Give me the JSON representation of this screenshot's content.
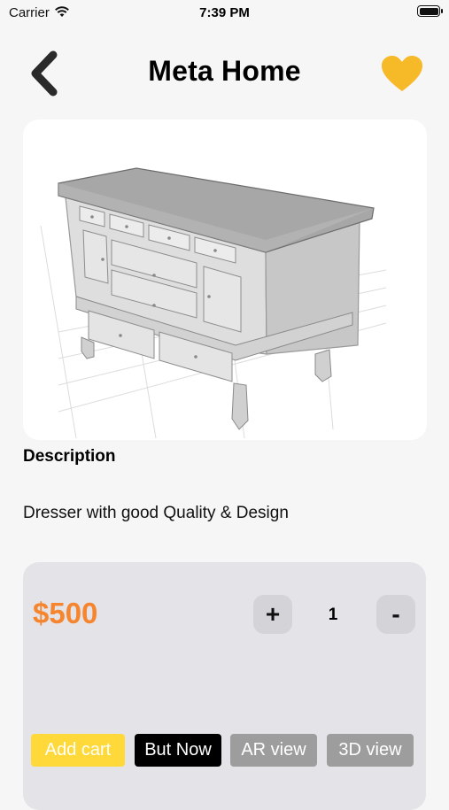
{
  "status_bar": {
    "carrier": "Carrier",
    "time": "7:39 PM"
  },
  "header": {
    "title": "Meta Home"
  },
  "product": {
    "description_heading": "Description",
    "description": "Dresser with good Quality & Design",
    "price": "$500",
    "quantity": "1"
  },
  "controls": {
    "plus": "+",
    "minus": "-"
  },
  "actions": {
    "add_cart": "Add cart",
    "buy_now": "But Now",
    "ar_view": "AR view",
    "view_3d": "3D view"
  },
  "colors": {
    "favorite": "#f6b928",
    "price": "#f5852e",
    "add_cart_bg": "#ffd93a",
    "buy_now_bg": "#000000",
    "secondary_bg": "#9d9d9d",
    "panel_bg": "#e4e4e8"
  },
  "icons": {
    "back": "chevron-left-icon",
    "favorite": "heart-icon",
    "wifi": "wifi-icon",
    "battery": "battery-icon"
  }
}
